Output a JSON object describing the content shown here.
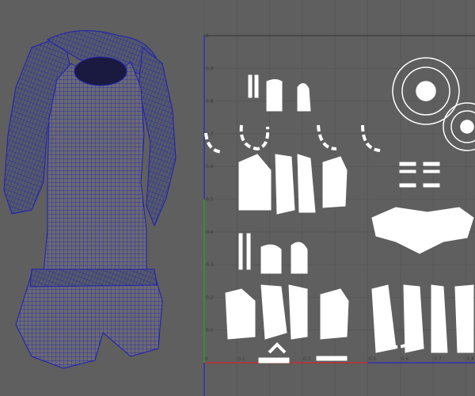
{
  "viewport": {
    "object": "character-wireframe-mesh",
    "wire_color": "#1e1eb4"
  },
  "uv_editor": {
    "u_ticks": [
      "0",
      "0.1",
      "0.2",
      "0.3",
      "0.4",
      "0.5",
      "0.6",
      "0.7",
      "0.8"
    ],
    "v_ticks": [
      "0",
      "0.1",
      "0.2",
      "0.3",
      "0.4",
      "0.5",
      "0.6",
      "0.7",
      "0.8",
      "0.9",
      "1"
    ],
    "axis_colors": {
      "u_axis": "#c03030",
      "v_axis_low": "#2e9a2e",
      "v_axis_high": "#3030b0",
      "u_axis_high": "#3030b0"
    },
    "shell_color": "#ffffff"
  }
}
